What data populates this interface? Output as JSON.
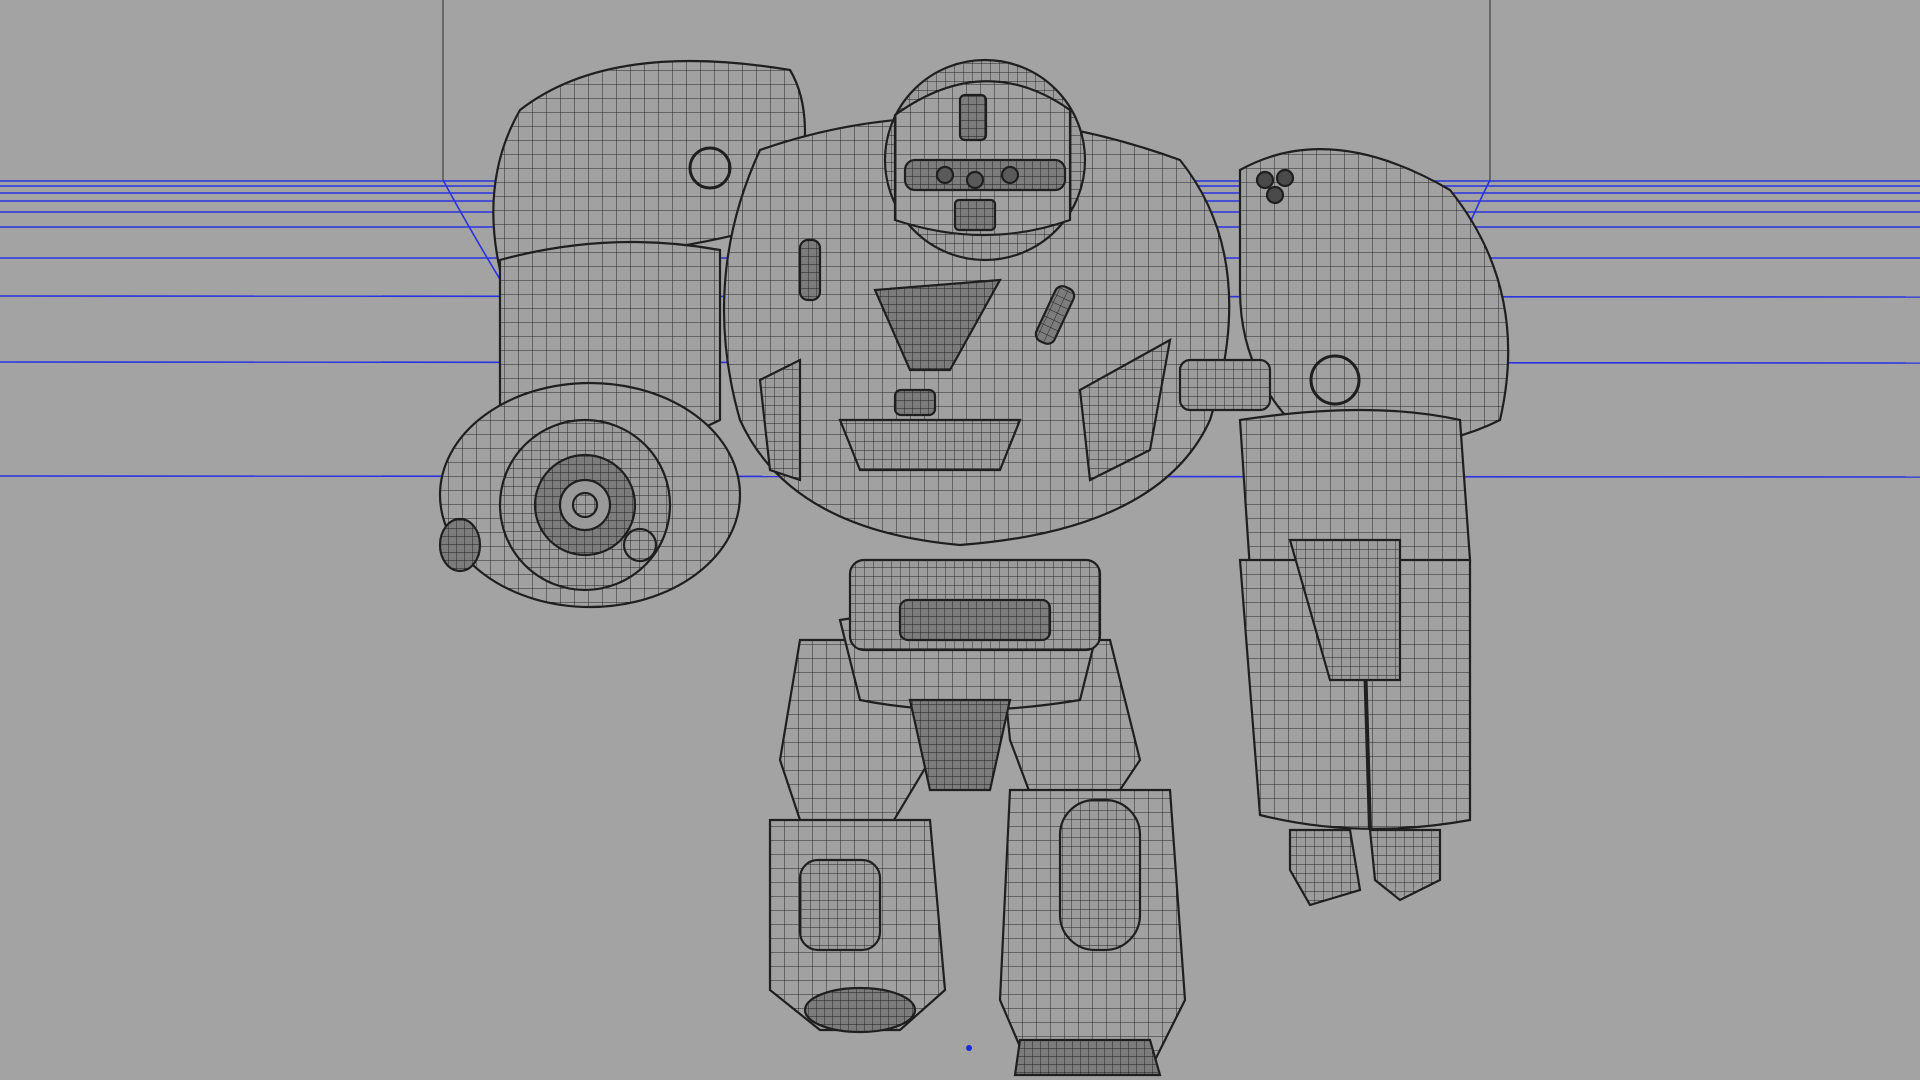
{
  "viewport": {
    "view": "perspective",
    "display_mode": "wireframe-on-shaded",
    "background_color": "#a3a3a3",
    "grid_line_color": "#2b33e0",
    "backdrop_edge_color": "#555555",
    "wire_color": "#262626",
    "surface_color": "#a1a1a1",
    "object": "robot-mech-mesh",
    "pivot_marker_color": "#1c2bd8"
  }
}
